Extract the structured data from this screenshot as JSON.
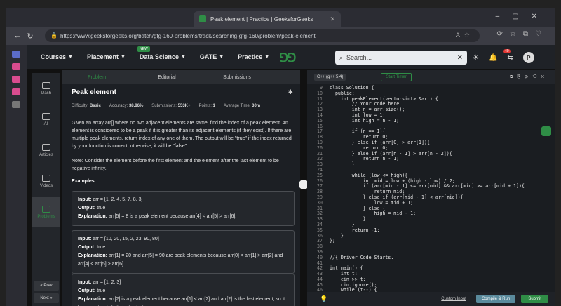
{
  "browser": {
    "tab_title": "Peak element | Practice | GeeksforGeeks",
    "url": "https://www.geeksforgeeks.org/batch/gfg-160-problems/track/searching-gfg-160/problem/peak-element",
    "profile_initial": "P"
  },
  "header": {
    "menus": [
      "Courses",
      "Placement",
      "Data Science",
      "GATE",
      "Practice"
    ],
    "new_badge": "NEW",
    "search_placeholder": "Search...",
    "notif_count": "40"
  },
  "nav": {
    "items": [
      "Dash",
      "All",
      "Articles",
      "Videos",
      "Problems"
    ],
    "prev": "« Prev",
    "next": "Next »"
  },
  "problem": {
    "tabs": [
      "Problem",
      "Editorial",
      "Submissions"
    ],
    "title": "Peak element",
    "difficulty_label": "Difficulty:",
    "difficulty": "Basic",
    "accuracy_label": "Accuracy:",
    "accuracy": "38.86%",
    "submissions_label": "Submissions:",
    "submissions": "553K+",
    "points_label": "Points:",
    "points": "1",
    "time_label": "Average Time:",
    "time": "30m",
    "description": "Given an array arr[] where no two adjacent elements are same, find the index of a peak element. An element is considered to be a peak if it is greater than its adjacent elements (if they exist). If there are multiple peak elements, return index of any one of them. The output will be \"true\" if the index returned by your function is correct; otherwise, it will be \"false\".",
    "note": "Note: Consider the element before the first element and the element after the last element to be negative infinity.",
    "examples_heading": "Examples :",
    "examples": [
      {
        "input": "arr = [1, 2, 4, 5, 7, 8, 3]",
        "output": "true",
        "explanation": "arr[5] = 8 is a peak element because arr[4] < arr[5] > arr[6]."
      },
      {
        "input": "arr = [10, 20, 15, 2, 23, 90, 80]",
        "output": "true",
        "explanation": "arr[1] = 20 and arr[5] = 90 are peak elements because arr[0] < arr[1] > arr[2] and arr[4] < arr[5] > arr[6]."
      },
      {
        "input": "arr = [1, 2, 3]",
        "output": "true",
        "explanation": "arr[2] is a peak element because arr[1] < arr[2] and arr[2] is the last element, so it has negative infinity to its right."
      }
    ]
  },
  "editor": {
    "language": "C++ (g++ 5.4)",
    "timer": "Start Timer",
    "lines": [
      {
        "n": "9",
        "t": "class Solution {"
      },
      {
        "n": "10",
        "t": "  public:"
      },
      {
        "n": "11",
        "t": "    int peakElement(vector<int> &arr) {"
      },
      {
        "n": "12",
        "t": "        // Your code here"
      },
      {
        "n": "13",
        "t": "        int n = arr.size();"
      },
      {
        "n": "14",
        "t": "        int low = 1;"
      },
      {
        "n": "15",
        "t": "        int high = n - 1;"
      },
      {
        "n": "16",
        "t": ""
      },
      {
        "n": "17",
        "t": "        if (n == 1){"
      },
      {
        "n": "18",
        "t": "            return 0;"
      },
      {
        "n": "19",
        "t": "        } else if (arr[0] > arr[1]){"
      },
      {
        "n": "20",
        "t": "            return 0;"
      },
      {
        "n": "21",
        "t": "        } else if (arr[n - 1] > arr[n - 2]){"
      },
      {
        "n": "22",
        "t": "            return n - 1;"
      },
      {
        "n": "23",
        "t": "        }"
      },
      {
        "n": "24",
        "t": ""
      },
      {
        "n": "25",
        "t": "        while (low <= high){"
      },
      {
        "n": "26",
        "t": "            int mid = low + (high - low) / 2;"
      },
      {
        "n": "27",
        "t": "            if (arr[mid - 1] <= arr[mid] && arr[mid] >= arr[mid + 1]){"
      },
      {
        "n": "28",
        "t": "                return mid;"
      },
      {
        "n": "29",
        "t": "            } else if (arr[mid - 1] < arr[mid]){"
      },
      {
        "n": "30",
        "t": "                low = mid + 1;"
      },
      {
        "n": "31",
        "t": "            } else {"
      },
      {
        "n": "32",
        "t": "                high = mid - 1;"
      },
      {
        "n": "33",
        "t": "            }"
      },
      {
        "n": "34",
        "t": "        }"
      },
      {
        "n": "35",
        "t": "        return -1;"
      },
      {
        "n": "36",
        "t": "    }"
      },
      {
        "n": "37",
        "t": "};"
      },
      {
        "n": "38",
        "t": ""
      },
      {
        "n": "39",
        "t": ""
      },
      {
        "n": "40",
        "t": "//{ Driver Code Starts."
      },
      {
        "n": "41",
        "t": ""
      },
      {
        "n": "42",
        "t": "int main() {"
      },
      {
        "n": "43",
        "t": "    int t;"
      },
      {
        "n": "44",
        "t": "    cin >> t;"
      },
      {
        "n": "45",
        "t": "    cin.ignore();"
      },
      {
        "n": "46",
        "t": "    while (t--) {"
      }
    ],
    "custom_input": "Custom Input",
    "compile": "Compile & Run",
    "submit": "Submit"
  }
}
